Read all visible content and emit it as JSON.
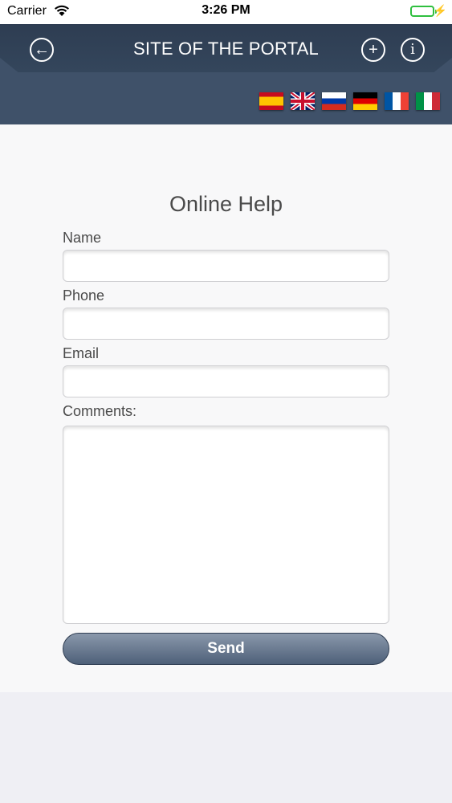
{
  "status_bar": {
    "carrier": "Carrier",
    "time": "3:26 PM",
    "wifi_icon": "wifi-icon",
    "battery_icon": "battery-full-icon",
    "charging_icon": "bolt-icon"
  },
  "header": {
    "title": "SITE OF THE PORTAL",
    "back_icon": "arrow-left-circle-icon",
    "back_glyph": "←",
    "add_icon": "plus-circle-icon",
    "add_glyph": "+",
    "info_icon": "info-circle-icon",
    "info_glyph": "i",
    "flags": [
      "spain-flag-icon",
      "uk-flag-icon",
      "russia-flag-icon",
      "germany-flag-icon",
      "france-flag-icon",
      "italy-flag-icon"
    ],
    "background_color": "#3f5169"
  },
  "form": {
    "title": "Online Help",
    "name_label": "Name",
    "name_value": "",
    "phone_label": "Phone",
    "phone_value": "",
    "email_label": "Email",
    "email_value": "",
    "comments_label": "Comments:",
    "comments_value": "",
    "send_label": "Send"
  }
}
